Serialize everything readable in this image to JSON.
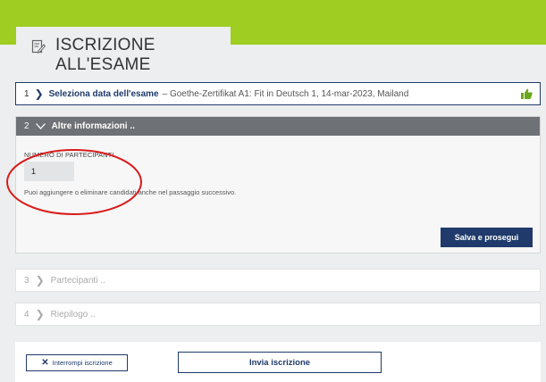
{
  "header": {
    "title": "ISCRIZIONE ALL'ESAME",
    "icon": "edit-document-icon"
  },
  "steps": {
    "step1": {
      "number": "1",
      "label": "Seleziona data dell'esame",
      "detail": "– Goethe-Zertifikat A1: Fit in Deutsch 1, 14-mar-2023, Mailand",
      "status_icon": "thumbs-up-icon"
    },
    "step2": {
      "number": "2",
      "label": "Altre informazioni ..",
      "field_label": "NUMERO DI PARTECIPANTI",
      "participants_value": "1",
      "hint": "Puoi aggiungere o eliminare candidati anche nel passaggio successivo.",
      "save_label": "Salva e prosegui"
    },
    "step3": {
      "number": "3",
      "label": "Partecipanti .."
    },
    "step4": {
      "number": "4",
      "label": "Riepilogo .."
    }
  },
  "footer": {
    "abort_label": "Interrompi iscrizione",
    "send_label": "Invia iscrizione"
  },
  "colors": {
    "brand_green": "#9fcd21",
    "navy": "#1f3a6b",
    "panel_header": "#6e7175",
    "annotation_red": "#d91c1c"
  }
}
